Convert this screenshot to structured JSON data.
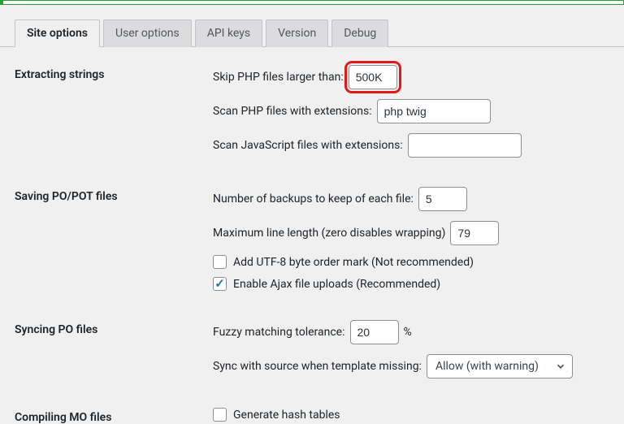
{
  "tabs": {
    "site_options": "Site options",
    "user_options": "User options",
    "api_keys": "API keys",
    "version": "Version",
    "debug": "Debug"
  },
  "sections": {
    "extracting": {
      "title": "Extracting strings",
      "skip_php_label": "Skip PHP files larger than:",
      "skip_php_value": "500K",
      "scan_php_label": "Scan PHP files with extensions:",
      "scan_php_value": "php twig",
      "scan_js_label": "Scan JavaScript files with extensions:",
      "scan_js_value": ""
    },
    "saving": {
      "title": "Saving PO/POT files",
      "backups_label": "Number of backups to keep of each file:",
      "backups_value": "5",
      "linelen_label": "Maximum line length (zero disables wrapping)",
      "linelen_value": "79",
      "bom_label": "Add UTF-8 byte order mark (Not recommended)",
      "ajax_label": "Enable Ajax file uploads (Recommended)"
    },
    "syncing": {
      "title": "Syncing PO files",
      "fuzzy_label": "Fuzzy matching tolerance:",
      "fuzzy_value": "20",
      "fuzzy_suffix": "%",
      "sync_missing_label": "Sync with source when template missing:",
      "sync_missing_value": "Allow (with warning)"
    },
    "compiling": {
      "title": "Compiling MO files",
      "hash_label": "Generate hash tables"
    }
  }
}
